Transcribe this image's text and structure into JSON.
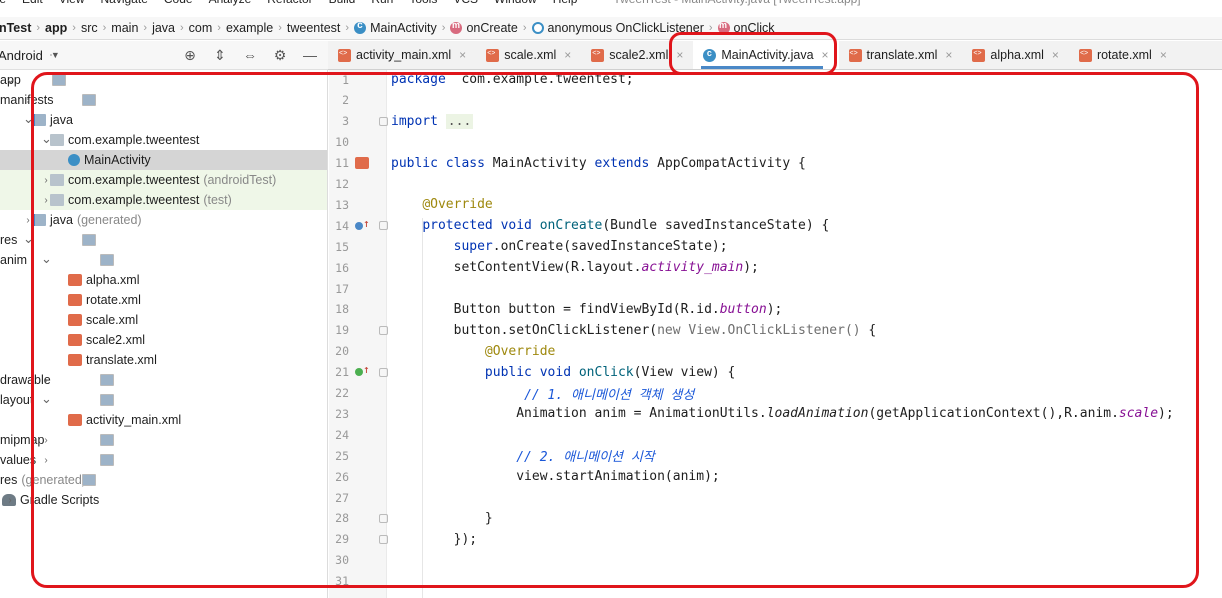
{
  "menu": {
    "items": [
      "ile",
      "Edit",
      "View",
      "Navigate",
      "Code",
      "Analyze",
      "Refactor",
      "Build",
      "Run",
      "Tools",
      "VCS",
      "Window",
      "Help"
    ],
    "window_title": "TweenTest - MainActivity.java [TweenTest.app]"
  },
  "breadcrumb": {
    "items": [
      "enTest",
      "app",
      "src",
      "main",
      "java",
      "com",
      "example",
      "tweentest",
      "MainActivity",
      "onCreate",
      "anonymous OnClickListener",
      "onClick"
    ]
  },
  "project_panel": {
    "view_mode": "Android"
  },
  "tabs": [
    {
      "label": "activity_main.xml",
      "type": "xml",
      "active": false
    },
    {
      "label": "scale.xml",
      "type": "xml",
      "active": false
    },
    {
      "label": "scale2.xml",
      "type": "xml",
      "active": false
    },
    {
      "label": "MainActivity.java",
      "type": "java",
      "active": true
    },
    {
      "label": "translate.xml",
      "type": "xml",
      "active": false
    },
    {
      "label": "alpha.xml",
      "type": "xml",
      "active": false
    },
    {
      "label": "rotate.xml",
      "type": "xml",
      "active": false
    }
  ],
  "tree": [
    {
      "label": "app",
      "suffix": "",
      "depth": 0,
      "icon": "fold",
      "chevron": "down",
      "dim": false,
      "state": ""
    },
    {
      "label": "manifests",
      "suffix": "",
      "depth": 1,
      "icon": "fold",
      "chevron": "right",
      "dim": false,
      "state": ""
    },
    {
      "label": "java",
      "suffix": "",
      "depth": 1,
      "icon": "foldsrc",
      "chevron": "down",
      "dim": false,
      "state": ""
    },
    {
      "label": "com.example.tweentest",
      "suffix": "",
      "depth": 2,
      "icon": "pkg",
      "chevron": "down",
      "dim": false,
      "state": ""
    },
    {
      "label": "MainActivity",
      "suffix": "",
      "depth": 3,
      "icon": "cls",
      "chevron": "",
      "dim": false,
      "state": "sel"
    },
    {
      "label": "com.example.tweentest",
      "suffix": "(androidTest)",
      "depth": 2,
      "icon": "pkg",
      "chevron": "right",
      "dim": false,
      "state": "test"
    },
    {
      "label": "com.example.tweentest",
      "suffix": "(test)",
      "depth": 2,
      "icon": "pkg",
      "chevron": "right",
      "dim": false,
      "state": "test"
    },
    {
      "label": "java",
      "suffix": "(generated)",
      "depth": 1,
      "icon": "foldsrc",
      "chevron": "right",
      "dim": false,
      "state": ""
    },
    {
      "label": "res",
      "suffix": "",
      "depth": 1,
      "icon": "fold",
      "chevron": "down",
      "dim": false,
      "state": ""
    },
    {
      "label": "anim",
      "suffix": "",
      "depth": 2,
      "icon": "fold",
      "chevron": "down",
      "dim": false,
      "state": ""
    },
    {
      "label": "alpha.xml",
      "suffix": "",
      "depth": 3,
      "icon": "xml",
      "chevron": "",
      "dim": false,
      "state": ""
    },
    {
      "label": "rotate.xml",
      "suffix": "",
      "depth": 3,
      "icon": "xml",
      "chevron": "",
      "dim": false,
      "state": ""
    },
    {
      "label": "scale.xml",
      "suffix": "",
      "depth": 3,
      "icon": "xml",
      "chevron": "",
      "dim": false,
      "state": ""
    },
    {
      "label": "scale2.xml",
      "suffix": "",
      "depth": 3,
      "icon": "xml",
      "chevron": "",
      "dim": false,
      "state": ""
    },
    {
      "label": "translate.xml",
      "suffix": "",
      "depth": 3,
      "icon": "xml",
      "chevron": "",
      "dim": false,
      "state": ""
    },
    {
      "label": "drawable",
      "suffix": "",
      "depth": 2,
      "icon": "fold",
      "chevron": "right",
      "dim": false,
      "state": ""
    },
    {
      "label": "layout",
      "suffix": "",
      "depth": 2,
      "icon": "fold",
      "chevron": "down",
      "dim": false,
      "state": ""
    },
    {
      "label": "activity_main.xml",
      "suffix": "",
      "depth": 3,
      "icon": "xml",
      "chevron": "",
      "dim": false,
      "state": ""
    },
    {
      "label": "mipmap",
      "suffix": "",
      "depth": 2,
      "icon": "fold",
      "chevron": "right",
      "dim": false,
      "state": ""
    },
    {
      "label": "values",
      "suffix": "",
      "depth": 2,
      "icon": "fold",
      "chevron": "right",
      "dim": false,
      "state": ""
    },
    {
      "label": "res",
      "suffix": "(generated)",
      "depth": 1,
      "icon": "fold",
      "chevron": "",
      "dim": false,
      "state": ""
    },
    {
      "label": "Gradle Scripts",
      "suffix": "",
      "depth": 0,
      "icon": "gradle",
      "chevron": "right",
      "dim": false,
      "state": ""
    }
  ],
  "editor": {
    "lines": [
      {
        "n": "1",
        "mark": "",
        "fold": false,
        "segs": [
          [
            "kw",
            "package"
          ],
          [
            "",
            "  com.example.tweentest;"
          ]
        ]
      },
      {
        "n": "2",
        "mark": "",
        "fold": false,
        "segs": []
      },
      {
        "n": "3",
        "mark": "",
        "fold": true,
        "segs": [
          [
            "kw",
            "import"
          ],
          [
            "",
            " "
          ],
          [
            "imp",
            "..."
          ]
        ]
      },
      {
        "n": "10",
        "mark": "",
        "fold": false,
        "segs": []
      },
      {
        "n": "11",
        "mark": "xml",
        "fold": false,
        "segs": [
          [
            "kw",
            "public class"
          ],
          [
            "",
            " MainActivity "
          ],
          [
            "kw",
            "extends"
          ],
          [
            "",
            " AppCompatActivity {"
          ]
        ]
      },
      {
        "n": "12",
        "mark": "",
        "fold": false,
        "segs": []
      },
      {
        "n": "13",
        "mark": "",
        "fold": false,
        "segs": [
          [
            "",
            "    "
          ],
          [
            "an",
            "@Override"
          ]
        ]
      },
      {
        "n": "14",
        "mark": "ov",
        "fold": true,
        "segs": [
          [
            "",
            "    "
          ],
          [
            "kw",
            "protected void"
          ],
          [
            "",
            " "
          ],
          [
            "fn",
            "onCreate"
          ],
          [
            "",
            "(Bundle savedInstanceState) {"
          ]
        ]
      },
      {
        "n": "15",
        "mark": "",
        "fold": false,
        "segs": [
          [
            "",
            "        "
          ],
          [
            "kw",
            "super"
          ],
          [
            "",
            ".onCreate(savedInstanceState);"
          ]
        ]
      },
      {
        "n": "16",
        "mark": "",
        "fold": false,
        "segs": [
          [
            "",
            "        setContentView(R.layout."
          ],
          [
            "fld",
            "activity_main"
          ],
          [
            "",
            ");"
          ]
        ]
      },
      {
        "n": "17",
        "mark": "",
        "fold": false,
        "segs": []
      },
      {
        "n": "18",
        "mark": "",
        "fold": false,
        "segs": [
          [
            "",
            "        Button button = findViewById(R.id."
          ],
          [
            "fld",
            "button"
          ],
          [
            "",
            ");"
          ]
        ]
      },
      {
        "n": "19",
        "mark": "",
        "fold": true,
        "segs": [
          [
            "",
            "        button.setOnClickListener("
          ],
          [
            "gray",
            "new View.OnClickListener()"
          ],
          [
            "",
            " {"
          ]
        ]
      },
      {
        "n": "20",
        "mark": "",
        "fold": false,
        "segs": [
          [
            "",
            "            "
          ],
          [
            "an",
            "@Override"
          ]
        ]
      },
      {
        "n": "21",
        "mark": "ovg",
        "fold": true,
        "segs": [
          [
            "",
            "            "
          ],
          [
            "kw",
            "public void"
          ],
          [
            "",
            " "
          ],
          [
            "fn",
            "onClick"
          ],
          [
            "",
            "(View view) {"
          ]
        ]
      },
      {
        "n": "22",
        "mark": "",
        "fold": false,
        "segs": [
          [
            "",
            "                 "
          ],
          [
            "cmko",
            "// 1. 애니메이션 객체 생성"
          ]
        ]
      },
      {
        "n": "23",
        "mark": "",
        "fold": false,
        "segs": [
          [
            "",
            "                Animation anim = AnimationUtils."
          ],
          [
            "st",
            "loadAnimation"
          ],
          [
            "",
            "(getApplicationContext(),R.anim."
          ],
          [
            "fld",
            "scale"
          ],
          [
            "",
            ");"
          ]
        ]
      },
      {
        "n": "24",
        "mark": "",
        "fold": false,
        "segs": []
      },
      {
        "n": "25",
        "mark": "",
        "fold": false,
        "segs": [
          [
            "",
            "                "
          ],
          [
            "cmko",
            "// 2. 애니메이션 시작"
          ]
        ]
      },
      {
        "n": "26",
        "mark": "",
        "fold": false,
        "segs": [
          [
            "",
            "                view.startAnimation(anim);"
          ]
        ]
      },
      {
        "n": "27",
        "mark": "",
        "fold": false,
        "segs": []
      },
      {
        "n": "28",
        "mark": "",
        "fold": true,
        "segs": [
          [
            "",
            "            }"
          ]
        ]
      },
      {
        "n": "29",
        "mark": "",
        "fold": true,
        "segs": [
          [
            "",
            "        });"
          ]
        ]
      },
      {
        "n": "30",
        "mark": "",
        "fold": false,
        "segs": []
      },
      {
        "n": "31",
        "mark": "",
        "fold": false,
        "segs": []
      }
    ]
  },
  "colors": {
    "highlight_red": "#e0151b",
    "active_tab_underline": "#4a88c7",
    "selection_gray": "#d5d5d5"
  }
}
